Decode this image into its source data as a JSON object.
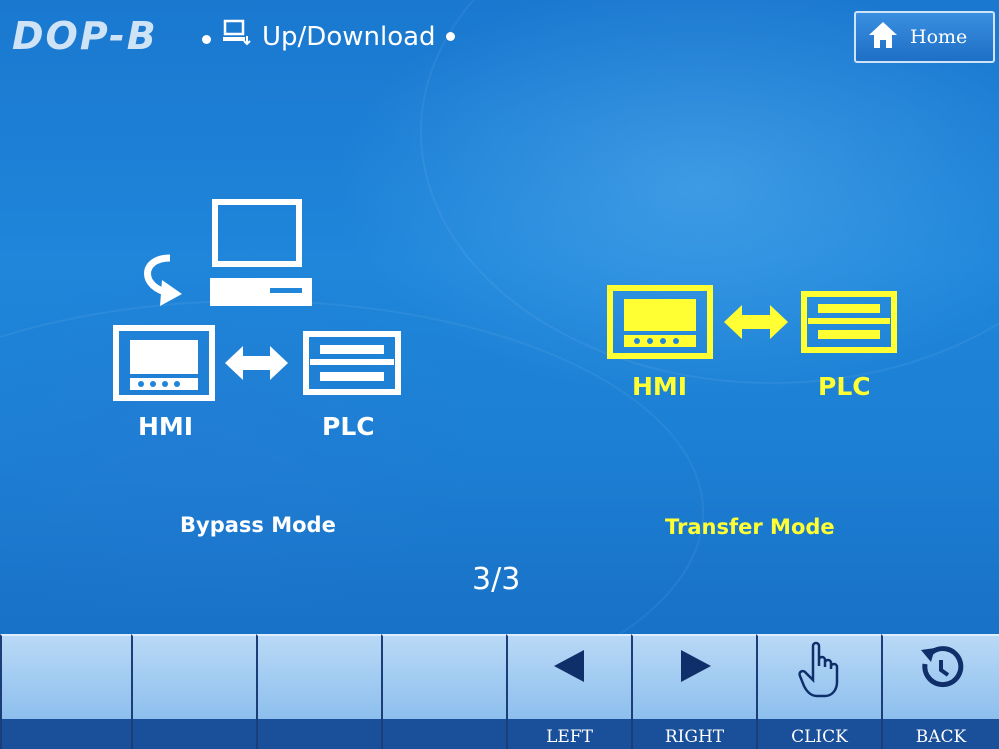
{
  "header": {
    "logo": "DOP-B",
    "title": "Up/Download",
    "home_label": "Home"
  },
  "diagram": {
    "bypass": {
      "hmi_label": "HMI",
      "plc_label": "PLC",
      "mode_label": "Bypass Mode"
    },
    "transfer": {
      "hmi_label": "HMI",
      "plc_label": "PLC",
      "mode_label": "Transfer Mode"
    }
  },
  "page_indicator": "3/3",
  "toolbar": {
    "buttons": [
      {
        "label": ""
      },
      {
        "label": ""
      },
      {
        "label": ""
      },
      {
        "label": ""
      },
      {
        "label": "LEFT",
        "icon": "left-arrow-icon"
      },
      {
        "label": "RIGHT",
        "icon": "right-arrow-icon"
      },
      {
        "label": "CLICK",
        "icon": "hand-pointer-icon"
      },
      {
        "label": "BACK",
        "icon": "back-rotate-icon"
      }
    ]
  },
  "colors": {
    "background": "#1f86da",
    "highlight": "#ffff33",
    "text": "#ffffff",
    "toolbar_foot": "#1a4f9a"
  }
}
